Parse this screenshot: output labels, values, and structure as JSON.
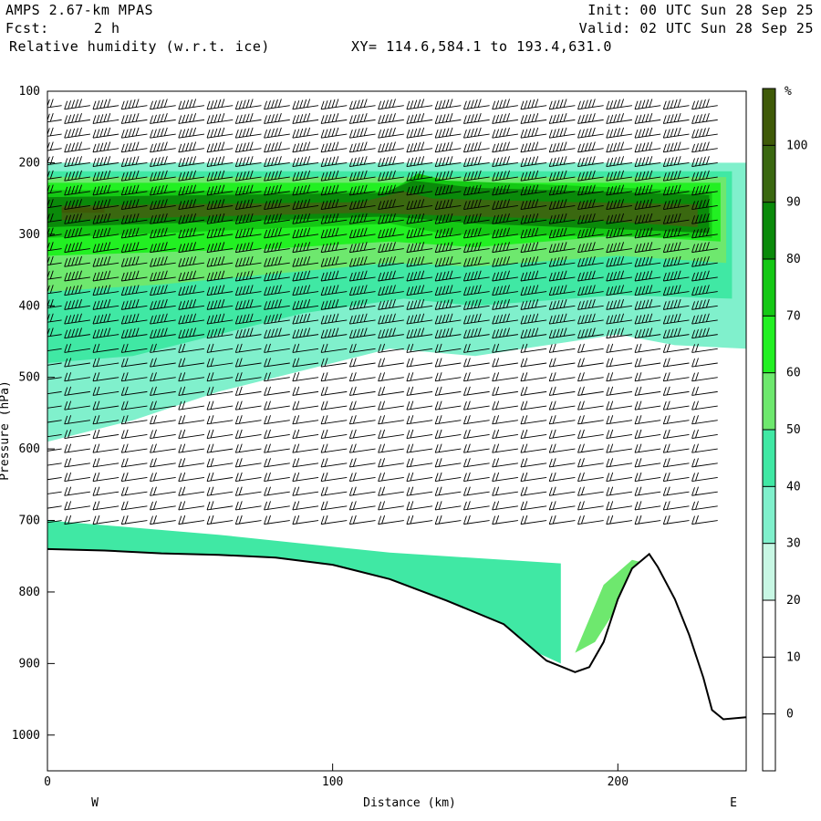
{
  "header": {
    "model": "AMPS 2.67-km MPAS",
    "fcst_label": "Fcst:",
    "fcst_value": "2 h",
    "field": "Relative humidity (w.r.t. ice)",
    "xy": "XY= 114.6,584.1 to 193.4,631.0",
    "init": "Init: 00 UTC Sun 28 Sep 25",
    "valid": "Valid: 02 UTC Sun 28 Sep 25"
  },
  "chart_data": {
    "type": "heatmap",
    "title": "Relative humidity (w.r.t. ice)",
    "xlabel": "Distance (km)",
    "ylabel": "Pressure (hPa)",
    "xlim": [
      0,
      245
    ],
    "ylim": [
      1050,
      100
    ],
    "x_ticks": [
      0,
      100,
      200
    ],
    "y_ticks": [
      100,
      200,
      300,
      400,
      500,
      600,
      700,
      800,
      900,
      1000
    ],
    "x_end_labels": {
      "left": "W",
      "right": "E"
    },
    "colorbar": {
      "unit": "%",
      "levels": [
        0,
        10,
        20,
        30,
        40,
        50,
        60,
        70,
        80,
        90,
        100
      ],
      "colors": [
        "#ffffff",
        "#ffffff",
        "#ffffff",
        "#c8f7e4",
        "#80f0cc",
        "#40e8a4",
        "#6ee86e",
        "#22f022",
        "#14c814",
        "#0a8a0a",
        "#3a6810",
        "#3f5a08"
      ]
    },
    "terrain_pressure": [
      [
        0,
        740
      ],
      [
        20,
        742
      ],
      [
        40,
        746
      ],
      [
        60,
        748
      ],
      [
        80,
        752
      ],
      [
        100,
        762
      ],
      [
        120,
        782
      ],
      [
        140,
        812
      ],
      [
        160,
        845
      ],
      [
        175,
        896
      ],
      [
        185,
        912
      ],
      [
        190,
        905
      ],
      [
        195,
        870
      ],
      [
        200,
        810
      ],
      [
        205,
        767
      ],
      [
        211,
        747
      ],
      [
        214,
        765
      ],
      [
        220,
        810
      ],
      [
        225,
        860
      ],
      [
        230,
        920
      ],
      [
        233,
        965
      ],
      [
        237,
        978
      ],
      [
        245,
        975
      ]
    ],
    "rh_regions": [
      {
        "level": 30,
        "boundary": [
          [
            0,
            200
          ],
          [
            245,
            200
          ],
          [
            245,
            460
          ],
          [
            220,
            455
          ],
          [
            200,
            440
          ],
          [
            150,
            470
          ],
          [
            120,
            460
          ],
          [
            100,
            480
          ],
          [
            60,
            520
          ],
          [
            30,
            560
          ],
          [
            0,
            590
          ]
        ]
      },
      {
        "level": 40,
        "boundary": [
          [
            0,
            212
          ],
          [
            240,
            212
          ],
          [
            240,
            390
          ],
          [
            200,
            385
          ],
          [
            150,
            400
          ],
          [
            125,
            390
          ],
          [
            90,
            410
          ],
          [
            60,
            440
          ],
          [
            30,
            470
          ],
          [
            0,
            480
          ]
        ]
      },
      {
        "level": 50,
        "boundary": [
          [
            0,
            220
          ],
          [
            238,
            220
          ],
          [
            238,
            340
          ],
          [
            200,
            330
          ],
          [
            150,
            345
          ],
          [
            120,
            340
          ],
          [
            80,
            355
          ],
          [
            40,
            370
          ],
          [
            0,
            380
          ]
        ]
      },
      {
        "level": 60,
        "boundary": [
          [
            0,
            228
          ],
          [
            236,
            228
          ],
          [
            236,
            310
          ],
          [
            200,
            302
          ],
          [
            150,
            318
          ],
          [
            120,
            310
          ],
          [
            80,
            320
          ],
          [
            40,
            325
          ],
          [
            0,
            330
          ]
        ]
      },
      {
        "level": 70,
        "boundary": [
          [
            0,
            238
          ],
          [
            120,
            240
          ],
          [
            130,
            215
          ],
          [
            140,
            225
          ],
          [
            233,
            240
          ],
          [
            233,
            305
          ],
          [
            140,
            300
          ],
          [
            120,
            285
          ],
          [
            0,
            305
          ]
        ]
      },
      {
        "level": 80,
        "boundary": [
          [
            0,
            248
          ],
          [
            118,
            242
          ],
          [
            128,
            225
          ],
          [
            150,
            235
          ],
          [
            232,
            245
          ],
          [
            232,
            298
          ],
          [
            150,
            285
          ],
          [
            120,
            275
          ],
          [
            0,
            290
          ]
        ]
      },
      {
        "level": 90,
        "boundary": [
          [
            5,
            260
          ],
          [
            110,
            255
          ],
          [
            125,
            240
          ],
          [
            135,
            250
          ],
          [
            185,
            255
          ],
          [
            228,
            258
          ],
          [
            228,
            290
          ],
          [
            190,
            280
          ],
          [
            110,
            270
          ],
          [
            5,
            280
          ]
        ]
      },
      {
        "level": 100,
        "boundary": [
          [
            5,
            263
          ],
          [
            20,
            263
          ],
          [
            20,
            270
          ],
          [
            5,
            270
          ]
        ]
      },
      {
        "level": 40,
        "boundary": [
          [
            0,
            700
          ],
          [
            60,
            720
          ],
          [
            120,
            745
          ],
          [
            180,
            760
          ],
          [
            180,
            900
          ],
          [
            120,
            790
          ],
          [
            60,
            760
          ],
          [
            0,
            745
          ]
        ]
      },
      {
        "level": 50,
        "boundary": [
          [
            185,
            885
          ],
          [
            195,
            790
          ],
          [
            205,
            755
          ],
          [
            210,
            760
          ],
          [
            200,
            820
          ],
          [
            192,
            870
          ]
        ]
      }
    ],
    "wind_barbs": {
      "columns_km": [
        5,
        15,
        25,
        35,
        45,
        55,
        65,
        75,
        85,
        95,
        105,
        115,
        125,
        135,
        145,
        155,
        165,
        175,
        185,
        195,
        205,
        215,
        225,
        235
      ],
      "levels_hpa": [
        120,
        140,
        160,
        180,
        200,
        220,
        240,
        260,
        280,
        300,
        320,
        340,
        360,
        380,
        400,
        420,
        440,
        460,
        480,
        500,
        520,
        540,
        560,
        580,
        600,
        620,
        640,
        660,
        680,
        700
      ],
      "direction_deg": 250,
      "speed_kt_upper": 50,
      "speed_kt_lower": 25
    }
  }
}
